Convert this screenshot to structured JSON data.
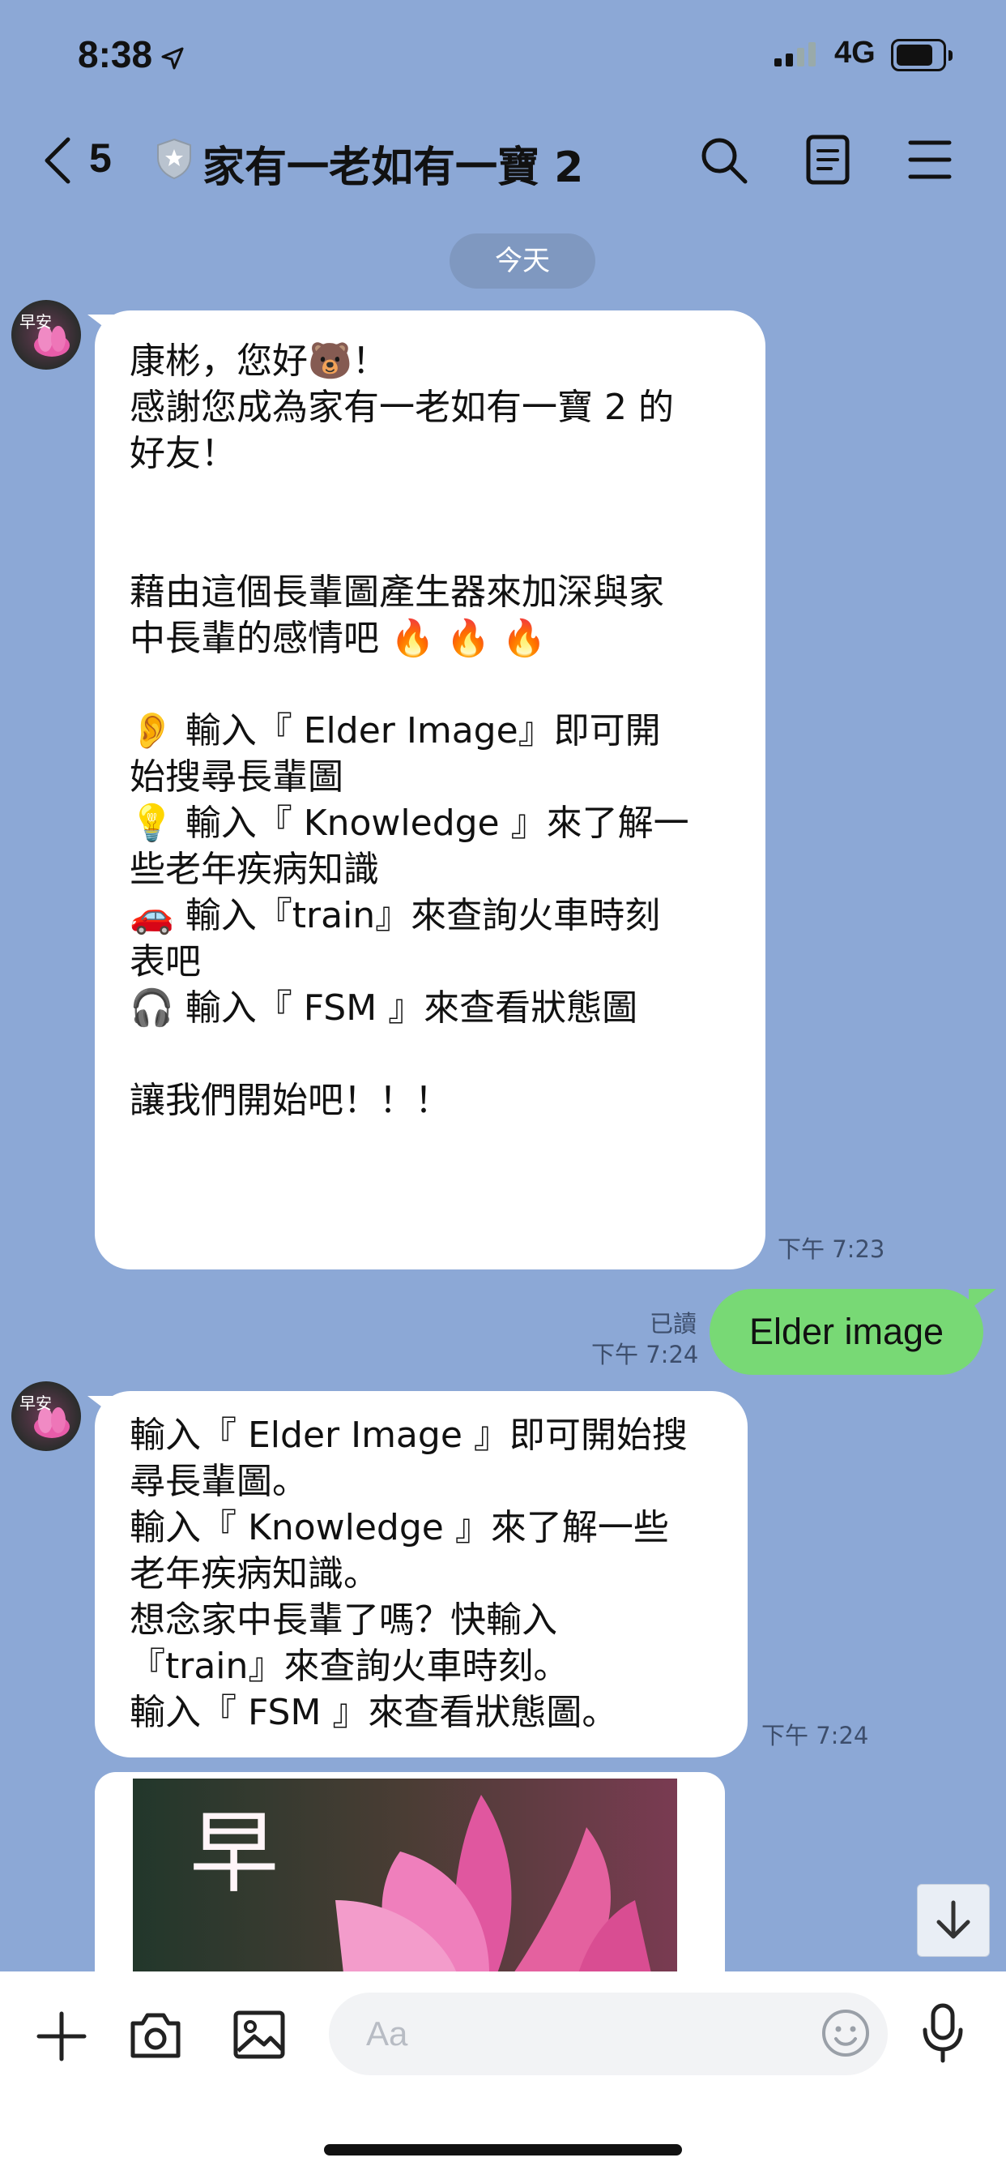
{
  "status_bar": {
    "time": "8:38",
    "network": "4G"
  },
  "header": {
    "unread_count": "5",
    "title": "家有一老如有一寶 2"
  },
  "date_divider": "今天",
  "messages": {
    "m1": {
      "lines": [
        "康彬，您好🐻！",
        "感謝您成為家有一老如有一寶 2 的",
        "好友！",
        "",
        "",
        "藉由這個長輩圖產生器來加深與家",
        "中長輩的感情吧 🔥 🔥 🔥",
        "",
        "👂 輸入『 Elder Image』即可開",
        "始搜尋長輩圖",
        "💡 輸入『 Knowledge 』來了解一",
        "些老年疾病知識",
        "🚗 輸入『train』來查詢火車時刻",
        "表吧",
        "🎧 輸入『 FSM 』來查看狀態圖",
        "",
        "讓我們開始吧！！！"
      ],
      "time": "下午 7:23"
    },
    "m2": {
      "text": "Elder image",
      "read_label": "已讀",
      "time": "下午 7:24"
    },
    "m3": {
      "lines": [
        "輸入『 Elder Image 』即可開始搜",
        "尋長輩圖。",
        "輸入『 Knowledge 』來了解一些",
        "老年疾病知識。",
        "想念家中長輩了嗎？快輸入",
        "『train』來查詢火車時刻。",
        "輸入『 FSM 』來查看狀態圖。"
      ],
      "time": "下午 7:24"
    },
    "m4": {
      "image_caption": "早"
    }
  },
  "avatar_caption": "早安",
  "input": {
    "placeholder": "Aa",
    "value": ""
  },
  "icons": {
    "back": "chevron-left-icon",
    "shield": "shield-icon",
    "search": "search-icon",
    "notes": "notes-icon",
    "menu": "menu-icon",
    "plus": "plus-icon",
    "camera": "camera-icon",
    "gallery": "image-icon",
    "emoji": "emoji-icon",
    "mic": "microphone-icon",
    "scroll": "arrow-down-icon"
  },
  "colors": {
    "background": "#8ca8d6",
    "outgoing_bubble": "#78d975",
    "incoming_bubble": "#ffffff",
    "date_chip": "#7f98c0"
  }
}
